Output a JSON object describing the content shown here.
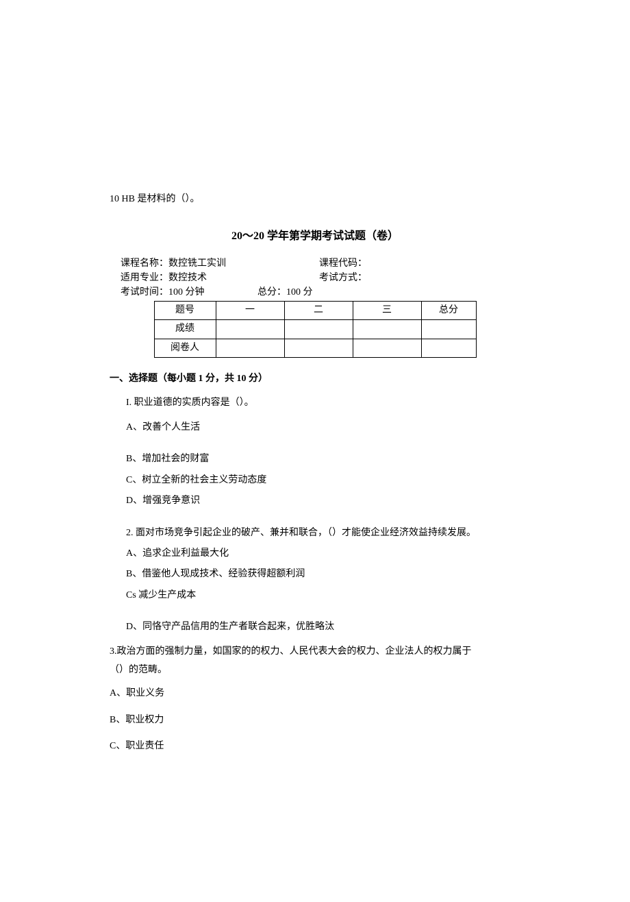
{
  "top_line": "10  HB 是材料的（）。",
  "title": "20～20 学年第学期考试试题（卷）",
  "info": {
    "course_name_label": "课程名称：",
    "course_name_value": "数控铣工实训",
    "course_code_label": "课程代码：",
    "major_label": "适用专业：",
    "major_value": "数控技术",
    "exam_mode_label": "考试方式：",
    "exam_time_label": "考试时间：",
    "exam_time_value": "100 分钟",
    "total_score_label": "总分：",
    "total_score_value": "100 分"
  },
  "table": {
    "row1_label": "题号",
    "col1": "一",
    "col2": "二",
    "col3": "三",
    "col_total": "总分",
    "row2_label": "成绩",
    "row3_label": "阅卷人"
  },
  "section1_heading": "一、选择题（每小题 1 分，共 10 分）",
  "q1": {
    "stem": "I. 职业道德的实质内容是（）。",
    "a": "A、改善个人生活",
    "b": "B、增加社会的财富",
    "c": "C、树立全新的社会主义劳动态度",
    "d": "D、增强竞争意识"
  },
  "q2": {
    "stem": "2. 面对市场竞争引起企业的破产、兼并和联合，（）才能使企业经济效益持续发展。",
    "a": "A、追求企业利益最大化",
    "b": "B、借鉴他人现成技术、经验获得超额利润",
    "c": "Cs 减少生产成本",
    "d": "D、同恪守产品信用的生产者联合起来，优胜略汰"
  },
  "q3": {
    "stem1": "3.政治方面的强制力量，如国家的的权力、人民代表大会的权力、企业法人的权力属于",
    "stem2": "（）的范畴。",
    "a": "A、职业义务",
    "b": "B、职业权力",
    "c": "C、职业责任"
  }
}
